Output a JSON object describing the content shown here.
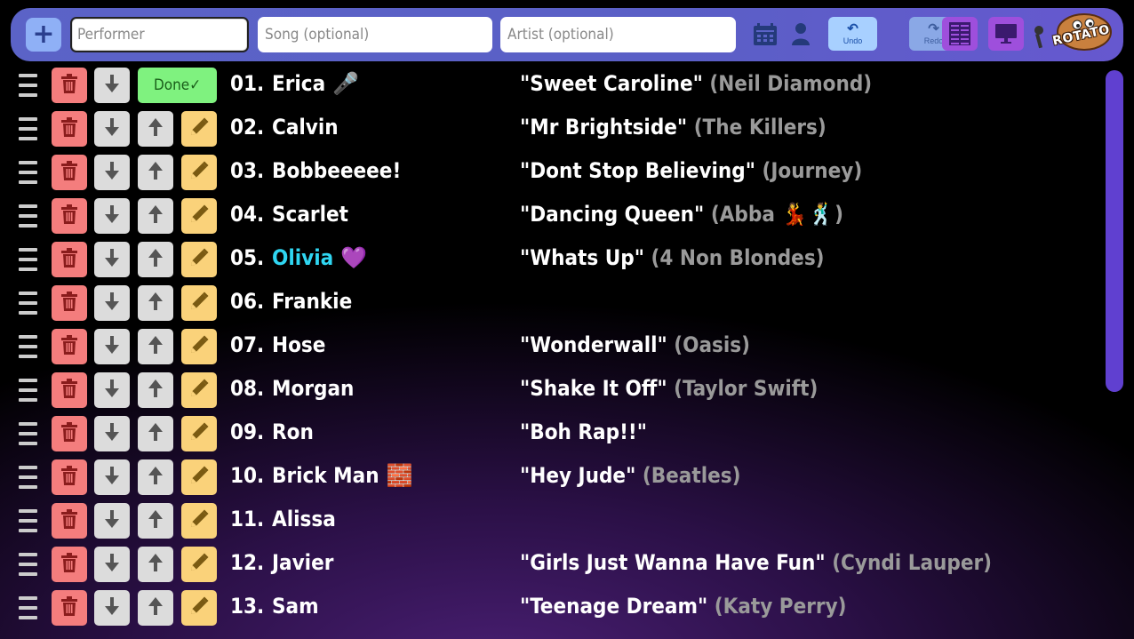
{
  "toolbar": {
    "performer_placeholder": "Performer",
    "song_placeholder": "Song (optional)",
    "artist_placeholder": "Artist (optional)",
    "undo_label": "Undo",
    "redo_label": "Redo",
    "logo_text": "ROTATO"
  },
  "colors": {
    "toolbar": "#5b63c7",
    "delete": "#f47d7d",
    "move": "#dcdcdc",
    "edit": "#fad27a",
    "done": "#7ff27f",
    "highlight_name": "#2fd6f2",
    "artist": "#9a9a9a",
    "scrollbar": "#6040d0"
  },
  "queue": {
    "done_label": "Done✓",
    "items": [
      {
        "num": "01.",
        "name": "Erica",
        "emoji": "🎤",
        "song": "\"Sweet Caroline\"",
        "artist": "(Neil Diamond)",
        "done": true
      },
      {
        "num": "02.",
        "name": "Calvin",
        "emoji": "",
        "song": "\"Mr Brightside\"",
        "artist": "(The Killers)"
      },
      {
        "num": "03.",
        "name": "Bobbeeeee!",
        "emoji": "",
        "song": "\"Dont Stop Believing\"",
        "artist": "(Journey)"
      },
      {
        "num": "04.",
        "name": "Scarlet",
        "emoji": "",
        "song": "\"Dancing Queen\"",
        "artist": "(Abba 💃🕺)"
      },
      {
        "num": "05.",
        "name": "Olivia",
        "emoji": "💜",
        "song": "\"Whats Up\"",
        "artist": "(4 Non Blondes)",
        "highlight": true
      },
      {
        "num": "06.",
        "name": "Frankie",
        "emoji": "",
        "song": "",
        "artist": ""
      },
      {
        "num": "07.",
        "name": "Hose",
        "emoji": "",
        "song": "\"Wonderwall\"",
        "artist": "(Oasis)"
      },
      {
        "num": "08.",
        "name": "Morgan",
        "emoji": "",
        "song": "\"Shake It Off\"",
        "artist": "(Taylor Swift)"
      },
      {
        "num": "09.",
        "name": "Ron",
        "emoji": "",
        "song": "\"Boh Rap!!\"",
        "artist": ""
      },
      {
        "num": "10.",
        "name": "Brick Man",
        "emoji": "🧱",
        "song": "\"Hey Jude\"",
        "artist": "(Beatles)"
      },
      {
        "num": "11.",
        "name": "Alissa",
        "emoji": "",
        "song": "",
        "artist": ""
      },
      {
        "num": "12.",
        "name": "Javier",
        "emoji": "",
        "song": "\"Girls Just Wanna Have Fun\"",
        "artist": "(Cyndi Lauper)"
      },
      {
        "num": "13.",
        "name": "Sam",
        "emoji": "",
        "song": "\"Teenage Dream\"",
        "artist": "(Katy Perry)"
      }
    ]
  }
}
